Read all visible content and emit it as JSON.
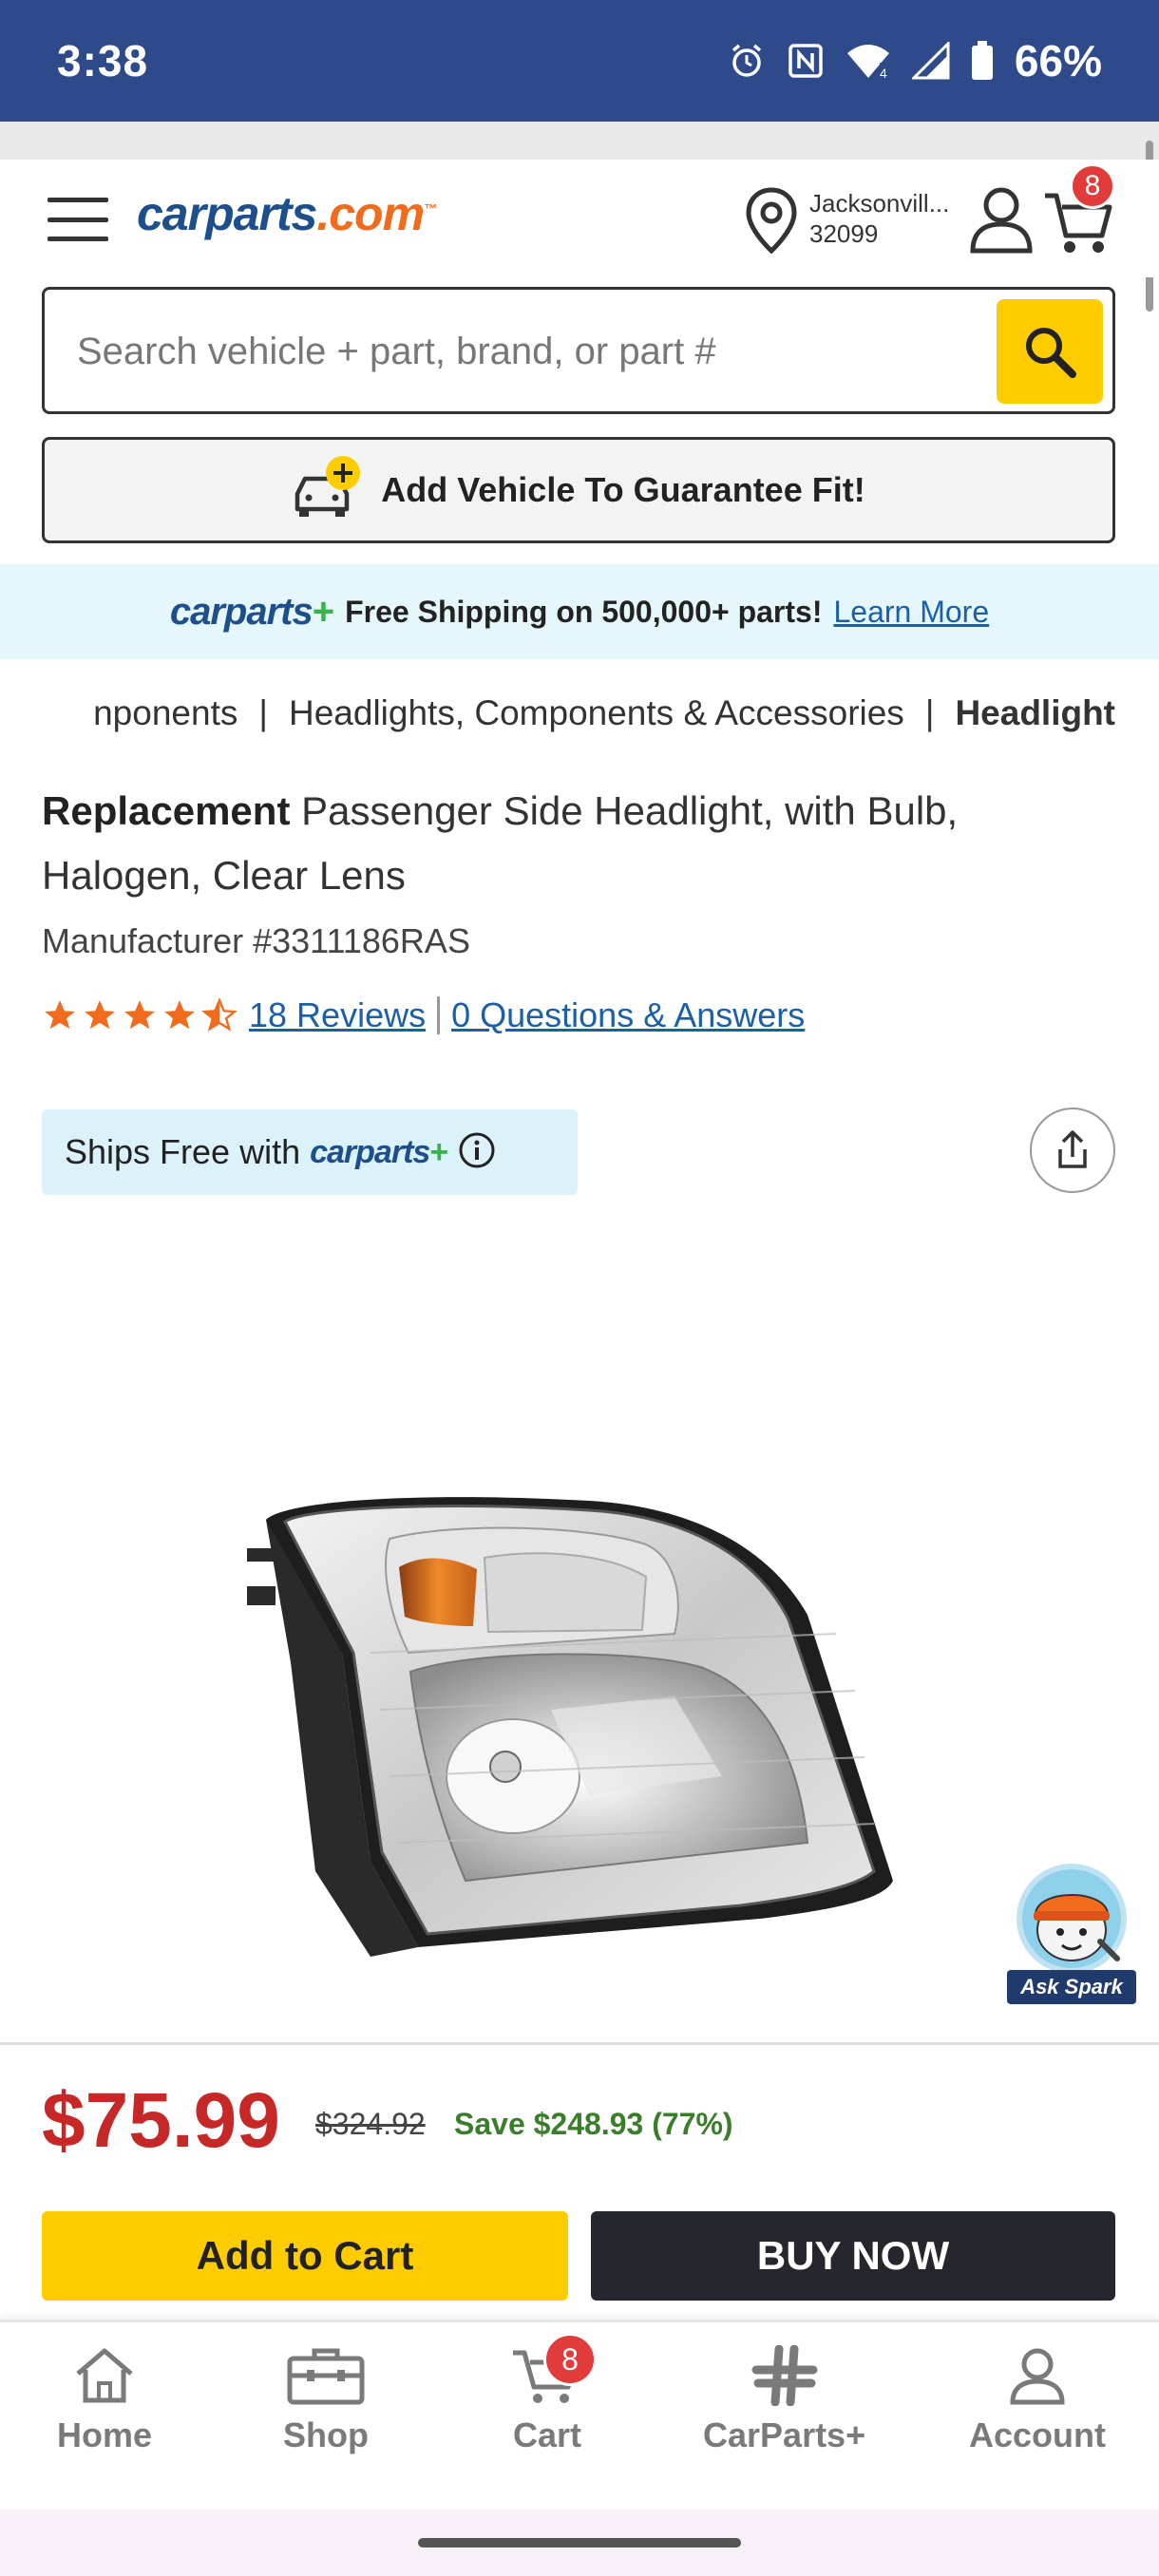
{
  "status_bar": {
    "time": "3:38",
    "battery": "66%",
    "icons": [
      "alarm-icon",
      "nfc-icon",
      "wifi-icon",
      "signal-icon",
      "battery-icon"
    ]
  },
  "header": {
    "logo_main": "carparts",
    "logo_suffix": ".com",
    "logo_tm": "™",
    "location_city": "Jacksonvill...",
    "location_zip": "32099",
    "cart_count": "8"
  },
  "search": {
    "placeholder": "Search vehicle + part, brand, or part #"
  },
  "add_vehicle": {
    "label": "Add Vehicle To Guarantee Fit!"
  },
  "shipping_banner": {
    "brand": "carparts",
    "plus": "+",
    "text": "Free Shipping on 500,000+ parts!",
    "link": "Learn More"
  },
  "breadcrumb": {
    "items": [
      "nponents",
      "|",
      "Headlights, Components & Accessories",
      "|",
      "Headlight"
    ]
  },
  "product": {
    "brand": "Replacement",
    "name": " Passenger Side Headlight, with Bulb, Halogen, Clear Lens",
    "manufacturer": "Manufacturer #3311186RAS",
    "rating": 4.5,
    "reviews_link": "18 Reviews",
    "qa_link": "0 Questions & Answers",
    "ships_free_text": "Ships Free with",
    "ships_free_brand": "carparts",
    "ships_free_plus": "+"
  },
  "ask_spark": {
    "label": "Ask Spark"
  },
  "pricing": {
    "price": "$75.99",
    "original_price": "$324.92",
    "savings": "Save $248.93 (77%)",
    "add_to_cart": "Add to Cart",
    "buy_now": "BUY NOW"
  },
  "bottom_nav": {
    "home": "Home",
    "shop": "Shop",
    "cart": "Cart",
    "cart_count": "8",
    "carparts_plus": "CarParts+",
    "account": "Account"
  },
  "colors": {
    "status_bar": "#2f4a8a",
    "accent_yellow": "#ffcc00",
    "price_red": "#c62828",
    "link_blue": "#1a5fa8",
    "save_green": "#3a7d2b",
    "badge_red": "#e23b3b"
  }
}
